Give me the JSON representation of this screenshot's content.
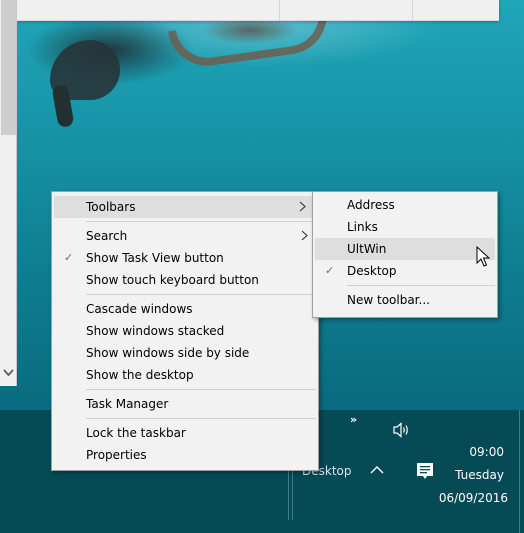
{
  "desktop": {
    "wallpaper": "underwater-diver"
  },
  "main_menu": {
    "groups": [
      [
        {
          "label": "Toolbars",
          "checked": false,
          "submenu": true,
          "highlighted": true
        }
      ],
      [
        {
          "label": "Search",
          "checked": false,
          "submenu": true
        },
        {
          "label": "Show Task View button",
          "checked": true,
          "submenu": false
        },
        {
          "label": "Show touch keyboard button",
          "checked": false,
          "submenu": false
        }
      ],
      [
        {
          "label": "Cascade windows",
          "checked": false
        },
        {
          "label": "Show windows stacked",
          "checked": false
        },
        {
          "label": "Show windows side by side",
          "checked": false
        },
        {
          "label": "Show the desktop",
          "checked": false
        }
      ],
      [
        {
          "label": "Task Manager",
          "checked": false
        }
      ],
      [
        {
          "label": "Lock the taskbar",
          "checked": false
        },
        {
          "label": "Properties",
          "checked": false
        }
      ]
    ],
    "check_glyph": "✓",
    "arrow_glyph": "›"
  },
  "toolbars_submenu": {
    "items": [
      {
        "label": "Address",
        "checked": false
      },
      {
        "label": "Links",
        "checked": false
      },
      {
        "label": "UltWin",
        "checked": false,
        "highlighted": true
      },
      {
        "label": "Desktop",
        "checked": true
      }
    ],
    "footer": {
      "label": "New toolbar..."
    }
  },
  "taskbar": {
    "desktop_toolbar_label": "Desktop",
    "overflow_glyph": "»",
    "clock": {
      "time": "09:00",
      "day": "Tuesday",
      "date": "06/09/2016"
    }
  },
  "colors": {
    "taskbar": "#064a55",
    "menu_bg": "#f2f2f2",
    "highlight": "#dedede",
    "check": "#5a6d8a"
  }
}
